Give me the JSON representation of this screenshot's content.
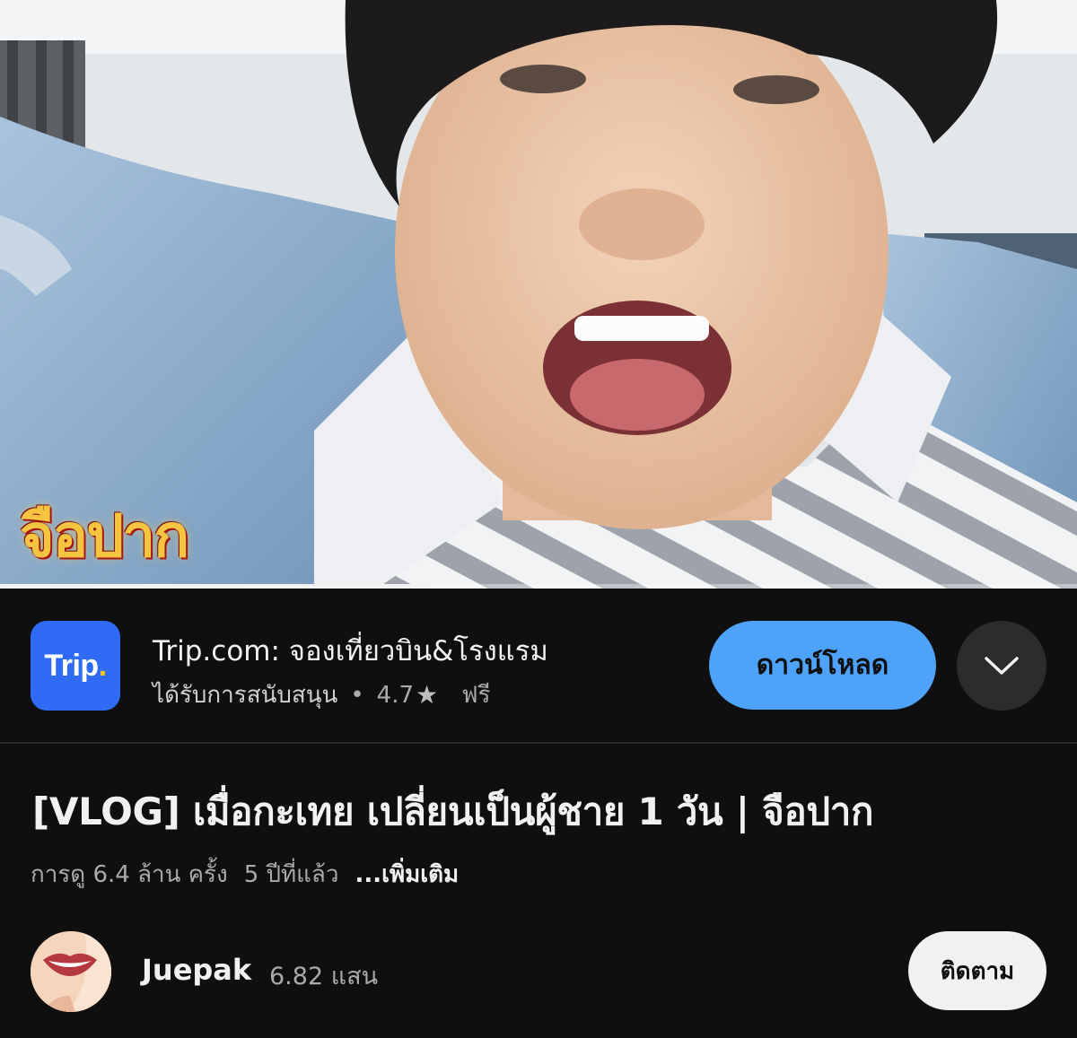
{
  "player": {
    "watermark": "จือปาก",
    "progress_fraction": 0.4
  },
  "ad": {
    "logo_text": "Trip",
    "logo_dot": ".",
    "title": "Trip.com: จองเที่ยวบิน&โรงแรม",
    "sponsored": "ได้รับการสนับสนุน",
    "separator": "•",
    "rating": "4.7",
    "price": "ฟรี",
    "download_label": "ดาวน์โหลด",
    "brand_color": "#2f6bf5",
    "button_color": "#4ea2f7"
  },
  "video": {
    "title": "[VLOG] เมื่อกะเทย เปลี่ยนเป็นผู้ชาย 1 วัน | จือปาก",
    "views": "การดู 6.4 ล้าน ครั้ง",
    "age": "5 ปีที่แล้ว",
    "more": "...เพิ่มเติม"
  },
  "channel": {
    "name": "Juepak",
    "subscribers": "6.82 แสน",
    "subscribe_label": "ติดตาม"
  }
}
